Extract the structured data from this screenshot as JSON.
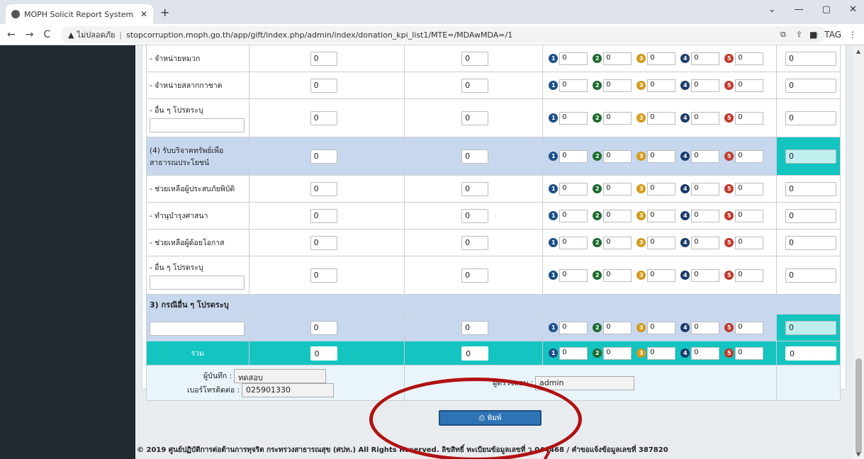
{
  "browser": {
    "tab_title": "MOPH Solicit Report System : M",
    "tab_close": "✕",
    "new_tab": "+",
    "win_min": "—",
    "win_max": "▢",
    "win_close": "✕",
    "back": "←",
    "forward": "→",
    "reload": "C",
    "security_label": "ไม่ปลอดภัย",
    "url": "stopcorruption.moph.go.th/app/gift/index.php/admin/index/donation_kpi_list1/MTE=/MDAwMDA=/1"
  },
  "rows": [
    {
      "label": "- จำหน่ายหมวก",
      "a": "0",
      "b": "0",
      "c": [
        "0",
        "0",
        "0",
        "0",
        "0"
      ],
      "d": "0",
      "blank": false,
      "style": "normal"
    },
    {
      "label": "- จำหน่ายสลากกาชาด",
      "a": "0",
      "b": "0",
      "c": [
        "0",
        "0",
        "0",
        "0",
        "0"
      ],
      "d": "0",
      "blank": false,
      "style": "normal"
    },
    {
      "label": "- อื่น ๆ โปรดระบุ",
      "a": "0",
      "b": "0",
      "c": [
        "0",
        "0",
        "0",
        "0",
        "0"
      ],
      "d": "0",
      "blank": true,
      "style": "normal"
    },
    {
      "label": "(4) รับบริจาคทรัพย์เพื่อสาธารณประโยชน์",
      "a": "0",
      "b": "0",
      "c": [
        "0",
        "0",
        "0",
        "0",
        "0"
      ],
      "d": "0",
      "blank": false,
      "style": "highlight"
    },
    {
      "label": "- ช่วยเหลือผู้ประสบภัยพิบัติ",
      "a": "0",
      "b": "0",
      "c": [
        "0",
        "0",
        "0",
        "0",
        "0"
      ],
      "d": "0",
      "blank": false,
      "style": "normal"
    },
    {
      "label": "- ทำนุบำรุงศาสนา",
      "a": "0",
      "b": "0",
      "c": [
        "0",
        "0",
        "0",
        "0",
        "0"
      ],
      "d": "0",
      "blank": false,
      "style": "normal"
    },
    {
      "label": "- ช่วยเหลือผู้ด้อยโอกาส",
      "a": "0",
      "b": "0",
      "c": [
        "0",
        "0",
        "0",
        "0",
        "0"
      ],
      "d": "0",
      "blank": false,
      "style": "normal"
    },
    {
      "label": "- อื่น ๆ โปรดระบุ",
      "a": "0",
      "b": "0",
      "c": [
        "0",
        "0",
        "0",
        "0",
        "0"
      ],
      "d": "0",
      "blank": true,
      "style": "normal"
    }
  ],
  "section3": {
    "label": "3) กรณีอื่น ๆ โปรดระบุ",
    "a": "0",
    "b": "0",
    "c": [
      "0",
      "0",
      "0",
      "0",
      "0"
    ],
    "d": "0"
  },
  "total": {
    "label": "รวม",
    "a": "0",
    "b": "0",
    "c": [
      "0",
      "0",
      "0",
      "0",
      "0"
    ],
    "d": "0"
  },
  "bullet_numbers": [
    "1",
    "2",
    "3",
    "4",
    "5"
  ],
  "bullet_colors": [
    "#1d4f8a",
    "#1e6b2f",
    "#d49a1a",
    "#1b3c6e",
    "#c0392b"
  ],
  "footer_info": {
    "recorder_label": "ผู้บันทึก :",
    "recorder_value": "ทดสอบ",
    "phone_label": "เบอร์โทรติดต่อ :",
    "phone_value": "025901330",
    "checker_label": "ผู้ตรวจสอบ :",
    "checker_value": "admin"
  },
  "print_button": "พิมพ์",
  "copyright": "© 2019 ศูนย์ปฏิบัติการต่อต้านการทุจริต กระทรวงสาธารณสุข (ศปท.) All Rights Reserved. ลิขสิทธิ์ ทะเบียนข้อมูลเลขที่ ว.044468 / คำขอแจ้งข้อมูลเลขที่ 387820",
  "annotation_color": "#b01212"
}
